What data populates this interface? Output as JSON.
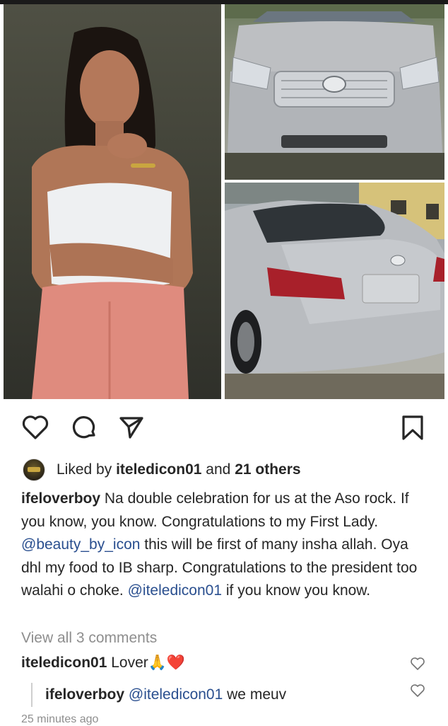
{
  "post": {
    "liked_by_prefix": "Liked by",
    "liked_by_user": "iteledicon01",
    "liked_by_and": "and",
    "liked_by_others": "21 others",
    "caption_user": "ifeloverboy",
    "caption_part1": "Na double celebration for us at the Aso rock. If you know, you know. Congratulations to my First Lady.",
    "caption_mention1": "@beauty_by_icon",
    "caption_part2": "this will be first of many insha allah.  Oya dhl my food to IB sharp. Congratulations to the president too walahi o choke.",
    "caption_mention2": "@iteledicon01",
    "caption_part3": "if you know you know.",
    "view_all_comments": "View all 3 comments",
    "timestamp": "25 minutes ago"
  },
  "comments": [
    {
      "user": "iteledicon01",
      "text": "Lover🙏❤️"
    },
    {
      "user": "ifeloverboy",
      "mention": "@iteledicon01",
      "text": "we meuv"
    }
  ],
  "icons": {
    "like": "heart-outline-icon",
    "comment": "comment-bubble-icon",
    "share": "send-paper-plane-icon",
    "save": "bookmark-icon"
  },
  "colors": {
    "text": "#262626",
    "mention": "#2a4f8f",
    "muted": "#8e8e8e",
    "background": "#ffffff"
  }
}
